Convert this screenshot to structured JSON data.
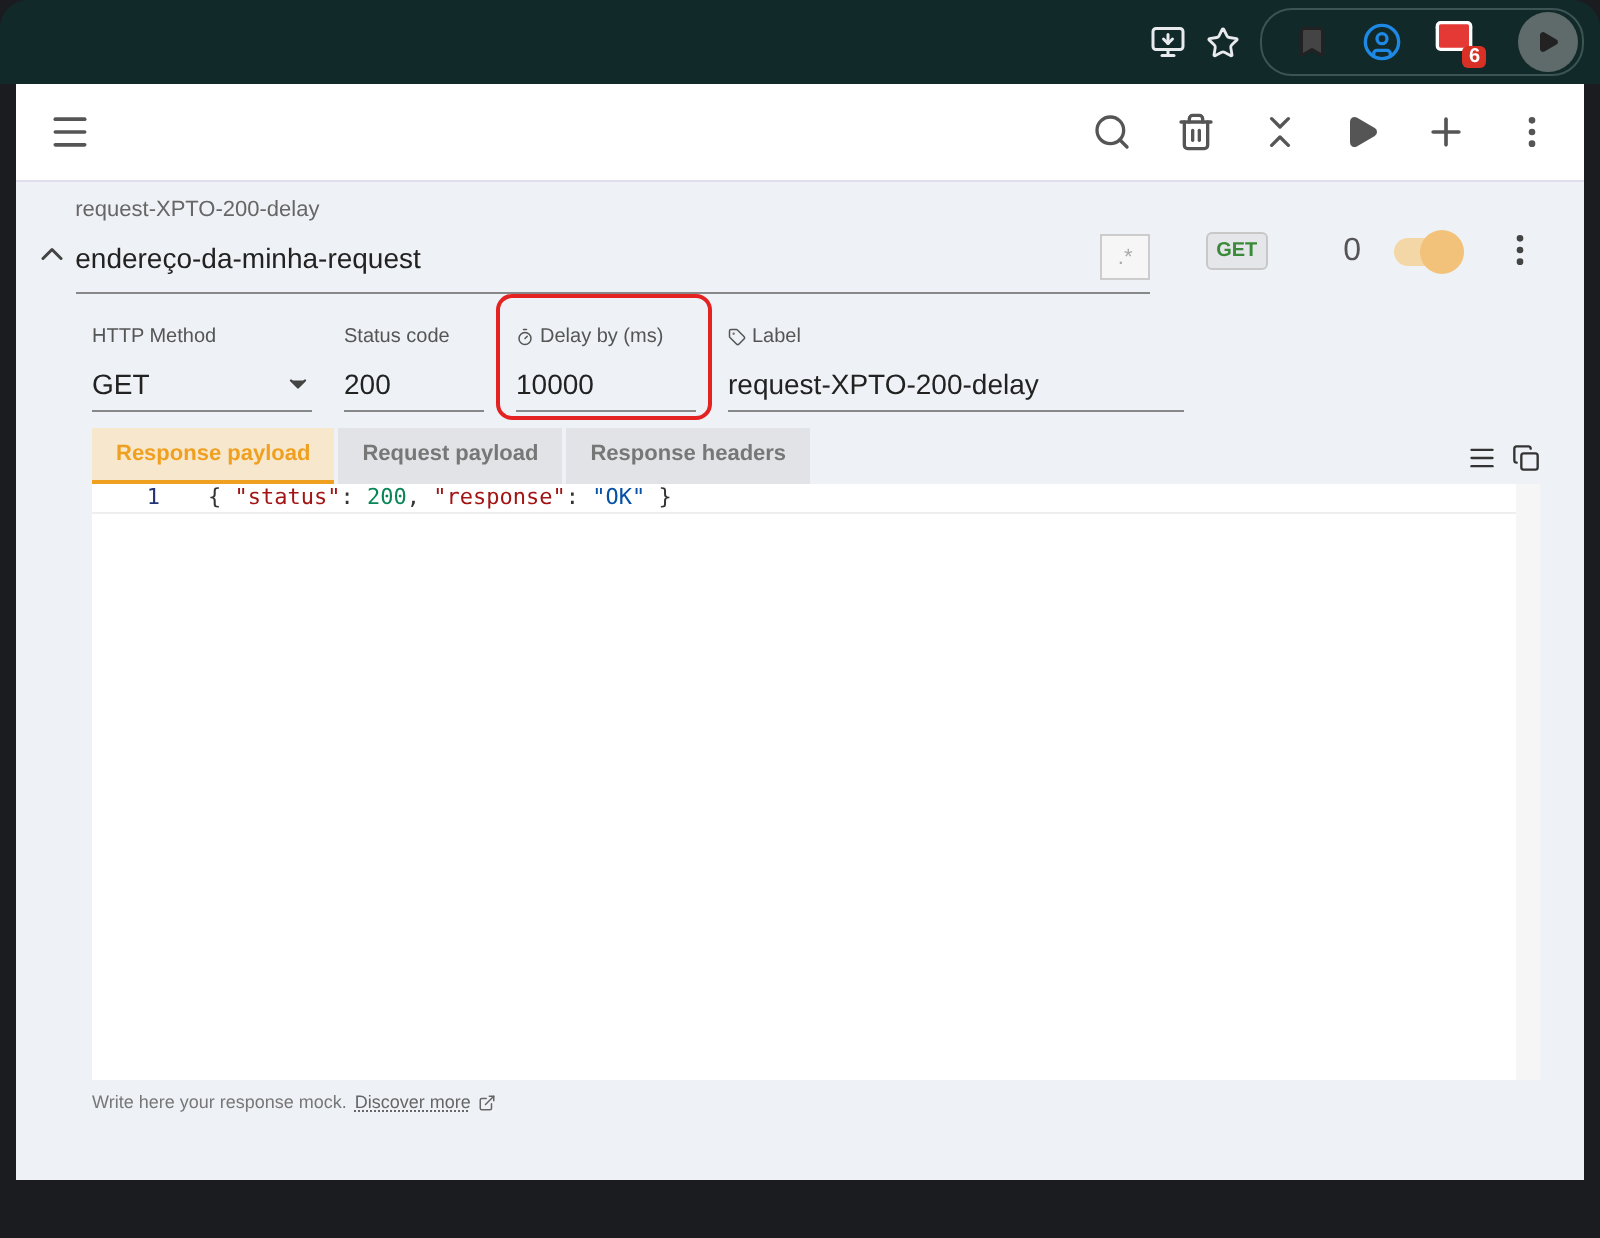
{
  "browser_toolbar": {
    "extension_badge": "6"
  },
  "request": {
    "caption": "request-XPTO-200-delay",
    "url": "endereço-da-minha-request",
    "expanded": true,
    "regex_button": ".*",
    "method_badge": "GET",
    "hit_count": "0",
    "enabled": true
  },
  "fields": [
    {
      "kind": "select",
      "label": "HTTP Method",
      "value": "GET",
      "highlighted": false
    },
    {
      "kind": "text",
      "label": "Status code",
      "value": "200",
      "highlighted": false
    },
    {
      "kind": "timer",
      "label": "Delay by (ms)",
      "value": "10000",
      "highlighted": true
    },
    {
      "kind": "tag",
      "label": "Label",
      "value": "request-XPTO-200-delay",
      "highlighted": false
    }
  ],
  "tabs": [
    {
      "label": "Response payload",
      "selected": true
    },
    {
      "label": "Request payload",
      "selected": false
    },
    {
      "label": "Response headers",
      "selected": false
    }
  ],
  "editor": {
    "lines": [
      {
        "number": "1",
        "tokens": [
          {
            "kind": "punct",
            "text": "{ "
          },
          {
            "kind": "key",
            "text": "\"status\""
          },
          {
            "kind": "punct",
            "text": ": "
          },
          {
            "kind": "number",
            "text": "200"
          },
          {
            "kind": "punct",
            "text": ", "
          },
          {
            "kind": "key",
            "text": "\"response\""
          },
          {
            "kind": "punct",
            "text": ": "
          },
          {
            "kind": "string",
            "text": "\"OK\""
          },
          {
            "kind": "punct",
            "text": " }"
          }
        ]
      }
    ]
  },
  "hint": {
    "text": "Write here your response mock.",
    "link": "Discover more"
  }
}
